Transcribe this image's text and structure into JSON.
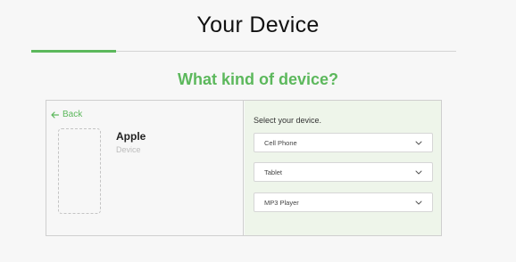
{
  "header": {
    "title": "Your Device",
    "progress_fraction": 0.2,
    "progress_color": "#5cb85c"
  },
  "question": "What kind of device?",
  "left_panel": {
    "back_label": "Back",
    "back_icon": "arrow-left-icon",
    "brand": "Apple",
    "brand_subtitle": "Device"
  },
  "right_panel": {
    "prompt": "Select your device.",
    "options": [
      {
        "label": "Cell Phone",
        "icon": "chevron-down-icon"
      },
      {
        "label": "Tablet",
        "icon": "chevron-down-icon"
      },
      {
        "label": "MP3 Player",
        "icon": "chevron-down-icon"
      }
    ],
    "background": "#eef5ea"
  }
}
